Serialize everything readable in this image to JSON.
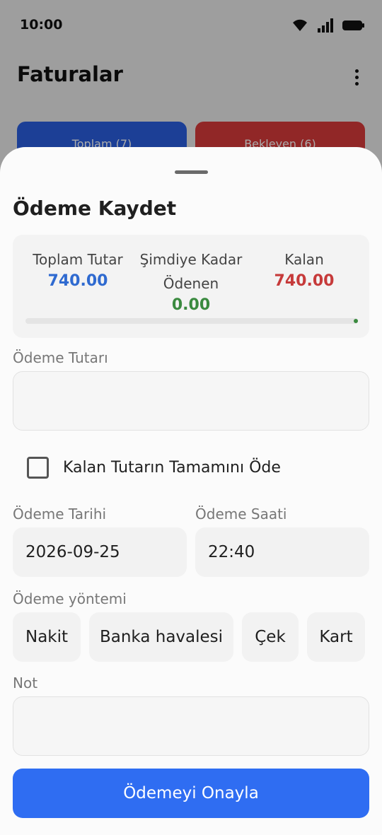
{
  "status_bar": {
    "time": "10:00"
  },
  "background": {
    "title": "Faturalar",
    "tabs": [
      {
        "label": "Toplam (7)",
        "color": "#2a5fe0"
      },
      {
        "label": "Bekleyen (6)",
        "color": "#d93b3b"
      }
    ]
  },
  "sheet": {
    "title": "Ödeme Kaydet",
    "summary": {
      "total_label": "Toplam Tutar",
      "total_value": "740.00",
      "paid_label_line1": "Şimdiye Kadar",
      "paid_label_line2": "Ödenen",
      "paid_value": "0.00",
      "remaining_label": "Kalan",
      "remaining_value": "740.00",
      "progress_fraction": 0.0
    },
    "amount": {
      "label": "Ödeme Tutarı",
      "value": ""
    },
    "pay_all": {
      "label": "Kalan Tutarın Tamamını Öde",
      "checked": false
    },
    "date": {
      "label": "Ödeme Tarihi",
      "value": "2026-09-25"
    },
    "time": {
      "label": "Ödeme Saati",
      "value": "22:40"
    },
    "method": {
      "label": "Ödeme yöntemi",
      "options": [
        "Nakit",
        "Banka havalesi",
        "Çek",
        "Kart"
      ]
    },
    "note": {
      "label": "Not",
      "value": ""
    },
    "confirm_label": "Ödemeyi Onayla"
  },
  "colors": {
    "primary": "#2f6df2",
    "total_blue": "#2f6ad0",
    "paid_green": "#3a8a3f",
    "remaining_red": "#c63a3a"
  }
}
